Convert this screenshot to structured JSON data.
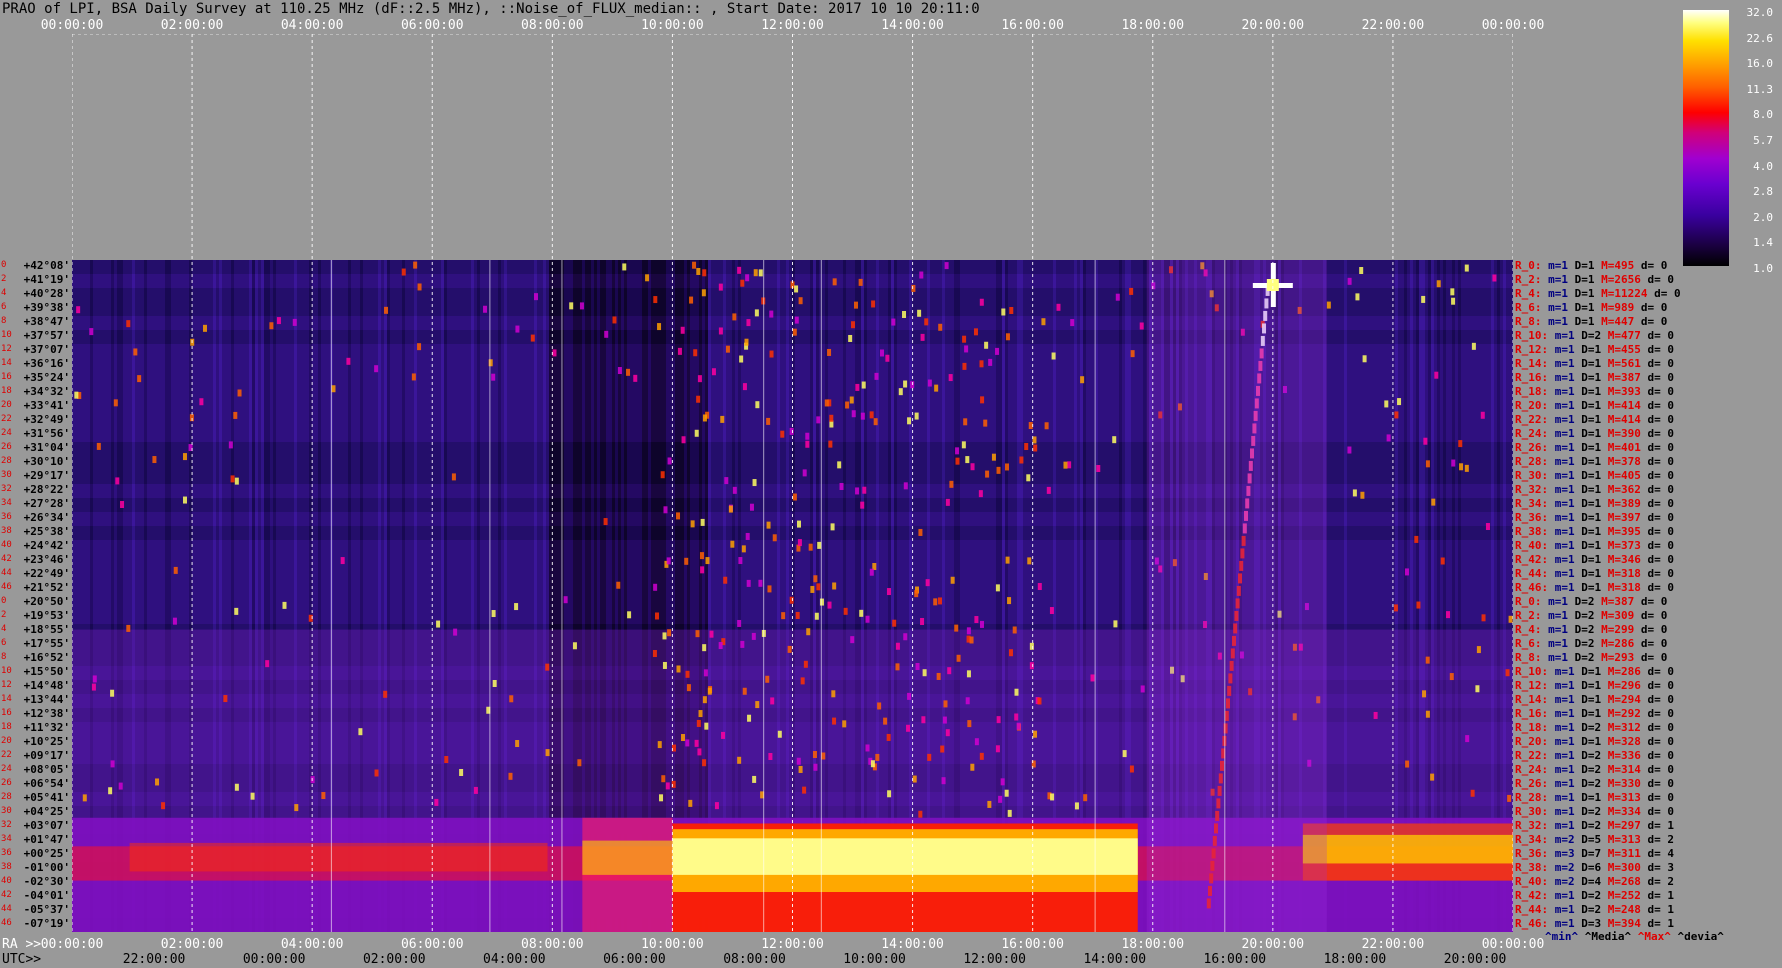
{
  "title": "PRAO of LPI, BSA Daily Survey at 110.25 MHz (dF::2.5 MHz), ::Noise_of_FLUX_median:: , Start Date: 2017 10 10 20:11:0",
  "chart_data": {
    "type": "heatmap",
    "title": "PRAO of LPI, BSA Daily Survey at 110.25 MHz (dF::2.5 MHz), ::Noise_of_FLUX_median:: , Start Date: 2017 10 10 20:11:0",
    "x_top_ticks": [
      "00:00:00",
      "02:00:00",
      "04:00:00",
      "06:00:00",
      "08:00:00",
      "10:00:00",
      "12:00:00",
      "14:00:00",
      "16:00:00",
      "18:00:00",
      "20:00:00",
      "22:00:00",
      "00:00:00"
    ],
    "ra_prefix": "RA >>",
    "ra_ticks": [
      "00:00:00",
      "02:00:00",
      "04:00:00",
      "06:00:00",
      "08:00:00",
      "10:00:00",
      "12:00:00",
      "14:00:00",
      "16:00:00",
      "18:00:00",
      "20:00:00",
      "22:00:00",
      "00:00:00"
    ],
    "utc_prefix": "UTC>>",
    "utc_ticks": [
      "22:00:00",
      "00:00:00",
      "02:00:00",
      "04:00:00",
      "06:00:00",
      "08:00:00",
      "10:00:00",
      "12:00:00",
      "14:00:00",
      "16:00:00",
      "18:00:00",
      "20:00:00"
    ],
    "declinations": [
      "+42°08'",
      "+41°19'",
      "+40°28'",
      "+39°38'",
      "+38°47'",
      "+37°57'",
      "+37°07'",
      "+36°16'",
      "+35°24'",
      "+34°32'",
      "+33°41'",
      "+32°49'",
      "+31°56'",
      "+31°04'",
      "+30°10'",
      "+29°17'",
      "+28°22'",
      "+27°28'",
      "+26°34'",
      "+25°38'",
      "+24°42'",
      "+23°46'",
      "+22°49'",
      "+21°52'",
      "+20°50'",
      "+19°53'",
      "+18°55'",
      "+17°55'",
      "+16°52'",
      "+15°50'",
      "+14°48'",
      "+13°44'",
      "+12°38'",
      "+11°32'",
      "+10°25'",
      "+09°17'",
      "+08°05'",
      "+06°54'",
      "+05°41'",
      "+04°25'",
      "+03°07'",
      "+01°47'",
      "+00°25'",
      "-01°00'",
      "-02°30'",
      "-04°01'",
      "-05°37'",
      "-07°19'"
    ],
    "row_index_labels": [
      "0",
      "2",
      "4",
      "6",
      "8",
      "10",
      "12",
      "14",
      "16",
      "18",
      "20",
      "22",
      "24",
      "26",
      "28",
      "30",
      "32",
      "34",
      "36",
      "38",
      "40",
      "42",
      "44",
      "46",
      "0",
      "2",
      "4",
      "6",
      "8",
      "10",
      "12",
      "14",
      "16",
      "18",
      "20",
      "22",
      "24",
      "26",
      "28",
      "30",
      "32",
      "34",
      "36",
      "38",
      "40",
      "42",
      "44",
      "46"
    ],
    "row_stats": [
      {
        "r": "R_0:",
        "m": "m=1",
        "d": "D=1",
        "max": "M=495",
        "dev": "d= 0"
      },
      {
        "r": "R_2:",
        "m": "m=1",
        "d": "D=1",
        "max": "M=2656",
        "dev": "d= 0"
      },
      {
        "r": "R_4:",
        "m": "m=1",
        "d": "D=1",
        "max": "M=11224",
        "dev": "d= 0"
      },
      {
        "r": "R_6:",
        "m": "m=1",
        "d": "D=1",
        "max": "M=989",
        "dev": "d= 0"
      },
      {
        "r": "R_8:",
        "m": "m=1",
        "d": "D=1",
        "max": "M=447",
        "dev": "d= 0"
      },
      {
        "r": "R_10:",
        "m": "m=1",
        "d": "D=2",
        "max": "M=477",
        "dev": "d= 0"
      },
      {
        "r": "R_12:",
        "m": "m=1",
        "d": "D=1",
        "max": "M=455",
        "dev": "d= 0"
      },
      {
        "r": "R_14:",
        "m": "m=1",
        "d": "D=1",
        "max": "M=561",
        "dev": "d= 0"
      },
      {
        "r": "R_16:",
        "m": "m=1",
        "d": "D=1",
        "max": "M=387",
        "dev": "d= 0"
      },
      {
        "r": "R_18:",
        "m": "m=1",
        "d": "D=1",
        "max": "M=393",
        "dev": "d= 0"
      },
      {
        "r": "R_20:",
        "m": "m=1",
        "d": "D=1",
        "max": "M=414",
        "dev": "d= 0"
      },
      {
        "r": "R_22:",
        "m": "m=1",
        "d": "D=1",
        "max": "M=414",
        "dev": "d= 0"
      },
      {
        "r": "R_24:",
        "m": "m=1",
        "d": "D=1",
        "max": "M=390",
        "dev": "d= 0"
      },
      {
        "r": "R_26:",
        "m": "m=1",
        "d": "D=1",
        "max": "M=401",
        "dev": "d= 0"
      },
      {
        "r": "R_28:",
        "m": "m=1",
        "d": "D=1",
        "max": "M=378",
        "dev": "d= 0"
      },
      {
        "r": "R_30:",
        "m": "m=1",
        "d": "D=1",
        "max": "M=405",
        "dev": "d= 0"
      },
      {
        "r": "R_32:",
        "m": "m=1",
        "d": "D=1",
        "max": "M=362",
        "dev": "d= 0"
      },
      {
        "r": "R_34:",
        "m": "m=1",
        "d": "D=1",
        "max": "M=389",
        "dev": "d= 0"
      },
      {
        "r": "R_36:",
        "m": "m=1",
        "d": "D=1",
        "max": "M=397",
        "dev": "d= 0"
      },
      {
        "r": "R_38:",
        "m": "m=1",
        "d": "D=1",
        "max": "M=395",
        "dev": "d= 0"
      },
      {
        "r": "R_40:",
        "m": "m=1",
        "d": "D=1",
        "max": "M=373",
        "dev": "d= 0"
      },
      {
        "r": "R_42:",
        "m": "m=1",
        "d": "D=1",
        "max": "M=346",
        "dev": "d= 0"
      },
      {
        "r": "R_44:",
        "m": "m=1",
        "d": "D=1",
        "max": "M=318",
        "dev": "d= 0"
      },
      {
        "r": "R_46:",
        "m": "m=1",
        "d": "D=1",
        "max": "M=318",
        "dev": "d= 0"
      },
      {
        "r": "R_0:",
        "m": "m=1",
        "d": "D=2",
        "max": "M=387",
        "dev": "d= 0"
      },
      {
        "r": "R_2:",
        "m": "m=1",
        "d": "D=2",
        "max": "M=309",
        "dev": "d= 0"
      },
      {
        "r": "R_4:",
        "m": "m=1",
        "d": "D=2",
        "max": "M=299",
        "dev": "d= 0"
      },
      {
        "r": "R_6:",
        "m": "m=1",
        "d": "D=2",
        "max": "M=286",
        "dev": "d= 0"
      },
      {
        "r": "R_8:",
        "m": "m=1",
        "d": "D=2",
        "max": "M=293",
        "dev": "d= 0"
      },
      {
        "r": "R_10:",
        "m": "m=1",
        "d": "D=1",
        "max": "M=286",
        "dev": "d= 0"
      },
      {
        "r": "R_12:",
        "m": "m=1",
        "d": "D=1",
        "max": "M=296",
        "dev": "d= 0"
      },
      {
        "r": "R_14:",
        "m": "m=1",
        "d": "D=1",
        "max": "M=294",
        "dev": "d= 0"
      },
      {
        "r": "R_16:",
        "m": "m=1",
        "d": "D=1",
        "max": "M=292",
        "dev": "d= 0"
      },
      {
        "r": "R_18:",
        "m": "m=1",
        "d": "D=2",
        "max": "M=312",
        "dev": "d= 0"
      },
      {
        "r": "R_20:",
        "m": "m=1",
        "d": "D=1",
        "max": "M=328",
        "dev": "d= 0"
      },
      {
        "r": "R_22:",
        "m": "m=1",
        "d": "D=2",
        "max": "M=336",
        "dev": "d= 0"
      },
      {
        "r": "R_24:",
        "m": "m=1",
        "d": "D=2",
        "max": "M=314",
        "dev": "d= 0"
      },
      {
        "r": "R_26:",
        "m": "m=1",
        "d": "D=2",
        "max": "M=330",
        "dev": "d= 0"
      },
      {
        "r": "R_28:",
        "m": "m=1",
        "d": "D=1",
        "max": "M=313",
        "dev": "d= 0"
      },
      {
        "r": "R_30:",
        "m": "m=1",
        "d": "D=2",
        "max": "M=334",
        "dev": "d= 0"
      },
      {
        "r": "R_32:",
        "m": "m=1",
        "d": "D=2",
        "max": "M=297",
        "dev": "d= 1"
      },
      {
        "r": "R_34:",
        "m": "m=2",
        "d": "D=5",
        "max": "M=313",
        "dev": "d= 2"
      },
      {
        "r": "R_36:",
        "m": "m=3",
        "d": "D=7",
        "max": "M=311",
        "dev": "d= 4"
      },
      {
        "r": "R_38:",
        "m": "m=2",
        "d": "D=6",
        "max": "M=300",
        "dev": "d= 3"
      },
      {
        "r": "R_40:",
        "m": "m=2",
        "d": "D=4",
        "max": "M=268",
        "dev": "d= 2"
      },
      {
        "r": "R_42:",
        "m": "m=1",
        "d": "D=2",
        "max": "M=252",
        "dev": "d= 1"
      },
      {
        "r": "R_44:",
        "m": "m=1",
        "d": "D=2",
        "max": "M=248",
        "dev": "d= 1"
      },
      {
        "r": "R_46:",
        "m": "m=1",
        "d": "D=3",
        "max": "M=394",
        "dev": "d= 1"
      }
    ],
    "legend": {
      "min": "^min^",
      "median": "^Media^",
      "max": "^Max^",
      "dev": "^devia^"
    },
    "colorbar": {
      "ticks": [
        "32.0",
        "22.6",
        "16.0",
        "11.3",
        "8.0",
        "5.7",
        "4.0",
        "2.8",
        "2.0",
        "1.4",
        "1.0"
      ],
      "colors": [
        "#000000",
        "#3a00a0",
        "#a000d0",
        "#ff0000",
        "#ff9a00",
        "#ffff80",
        "#ffffff"
      ]
    },
    "colors": {
      "background": "#999999",
      "grid_white": "#ffffff",
      "label_red": "#e00000",
      "label_navy": "#000080"
    }
  }
}
